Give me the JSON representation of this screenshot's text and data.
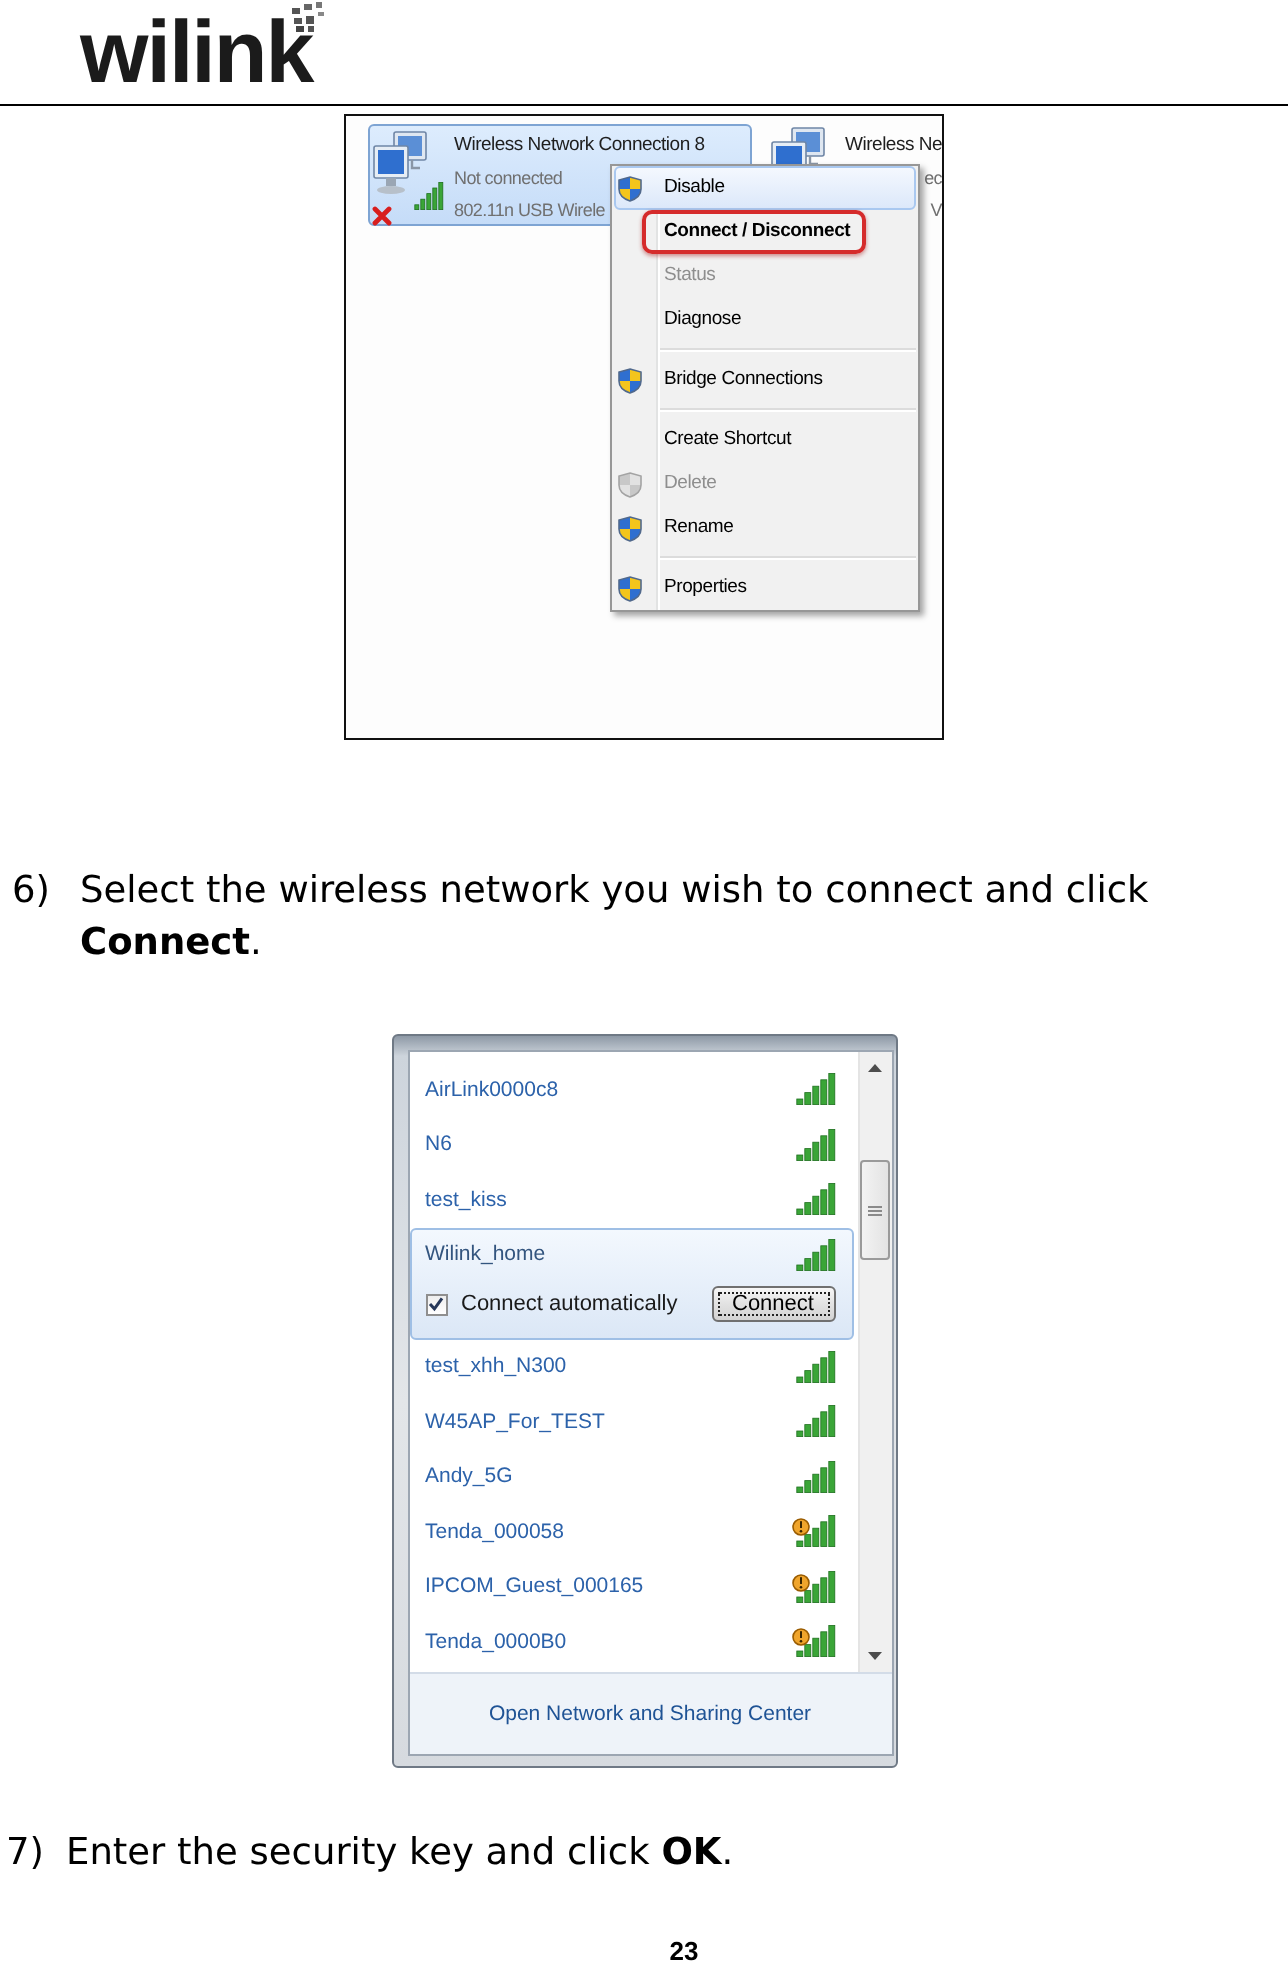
{
  "header": {
    "logo": "wilink"
  },
  "figure_1": {
    "connection": {
      "name": "Wireless Network Connection 8",
      "status": "Not connected",
      "adapter": "802.11n USB Wirele",
      "selected": true,
      "disconnected": true
    },
    "covered_connection": {
      "name": "Wireless Ne",
      "line_2": "ec",
      "line_3": "V"
    },
    "context_menu": {
      "groups": [
        {
          "items": [
            {
              "label": "Disable",
              "kind": "shield",
              "selected": true,
              "disabled": false,
              "is_default": false,
              "callout": false
            },
            {
              "label": "Connect / Disconnect",
              "kind": "plain",
              "selected": false,
              "disabled": false,
              "is_default": true,
              "callout": true
            },
            {
              "label": "Status",
              "kind": "plain",
              "selected": false,
              "disabled": true,
              "is_default": false,
              "callout": false
            },
            {
              "label": "Diagnose",
              "kind": "plain",
              "selected": false,
              "disabled": false,
              "is_default": false,
              "callout": false
            }
          ]
        },
        {
          "items": [
            {
              "label": "Bridge Connections",
              "kind": "shield",
              "selected": false,
              "disabled": false,
              "is_default": false,
              "callout": false
            }
          ]
        },
        {
          "items": [
            {
              "label": "Create Shortcut",
              "kind": "plain",
              "selected": false,
              "disabled": false,
              "is_default": false,
              "callout": false
            },
            {
              "label": "Delete",
              "kind": "shield",
              "selected": false,
              "disabled": true,
              "is_default": false,
              "callout": false
            },
            {
              "label": "Rename",
              "kind": "shield",
              "selected": false,
              "disabled": false,
              "is_default": false,
              "callout": false
            }
          ]
        },
        {
          "items": [
            {
              "label": "Properties",
              "kind": "shield",
              "selected": false,
              "disabled": false,
              "is_default": false,
              "callout": false
            }
          ]
        }
      ]
    }
  },
  "step_6": {
    "number": "6)",
    "text": "Select the wireless network you wish to connect and click **Connect**."
  },
  "figure_2": {
    "networks": [
      {
        "name": "AirLink0000c8",
        "selected": false,
        "warning": false
      },
      {
        "name": "N6",
        "selected": false,
        "warning": false
      },
      {
        "name": "test_kiss",
        "selected": false,
        "warning": false
      },
      {
        "name": "Wilink_home",
        "selected": true,
        "warning": false,
        "connect_options": {
          "label": "Connect automatically",
          "checked": true,
          "button": "Connect"
        }
      },
      {
        "name": "test_xhh_N300",
        "selected": false,
        "warning": false
      },
      {
        "name": "W45AP_For_TEST",
        "selected": false,
        "warning": false
      },
      {
        "name": "Andy_5G",
        "selected": false,
        "warning": false
      },
      {
        "name": "Tenda_000058",
        "selected": false,
        "warning": true
      },
      {
        "name": "IPCOM_Guest_000165",
        "selected": false,
        "warning": true
      },
      {
        "name": "Tenda_0000B0",
        "selected": false,
        "warning": true
      }
    ],
    "footer_link": "Open Network and Sharing Center"
  },
  "step_7": {
    "number": "7)",
    "text": "Enter the security key and click **OK**."
  },
  "page_number": "23"
}
